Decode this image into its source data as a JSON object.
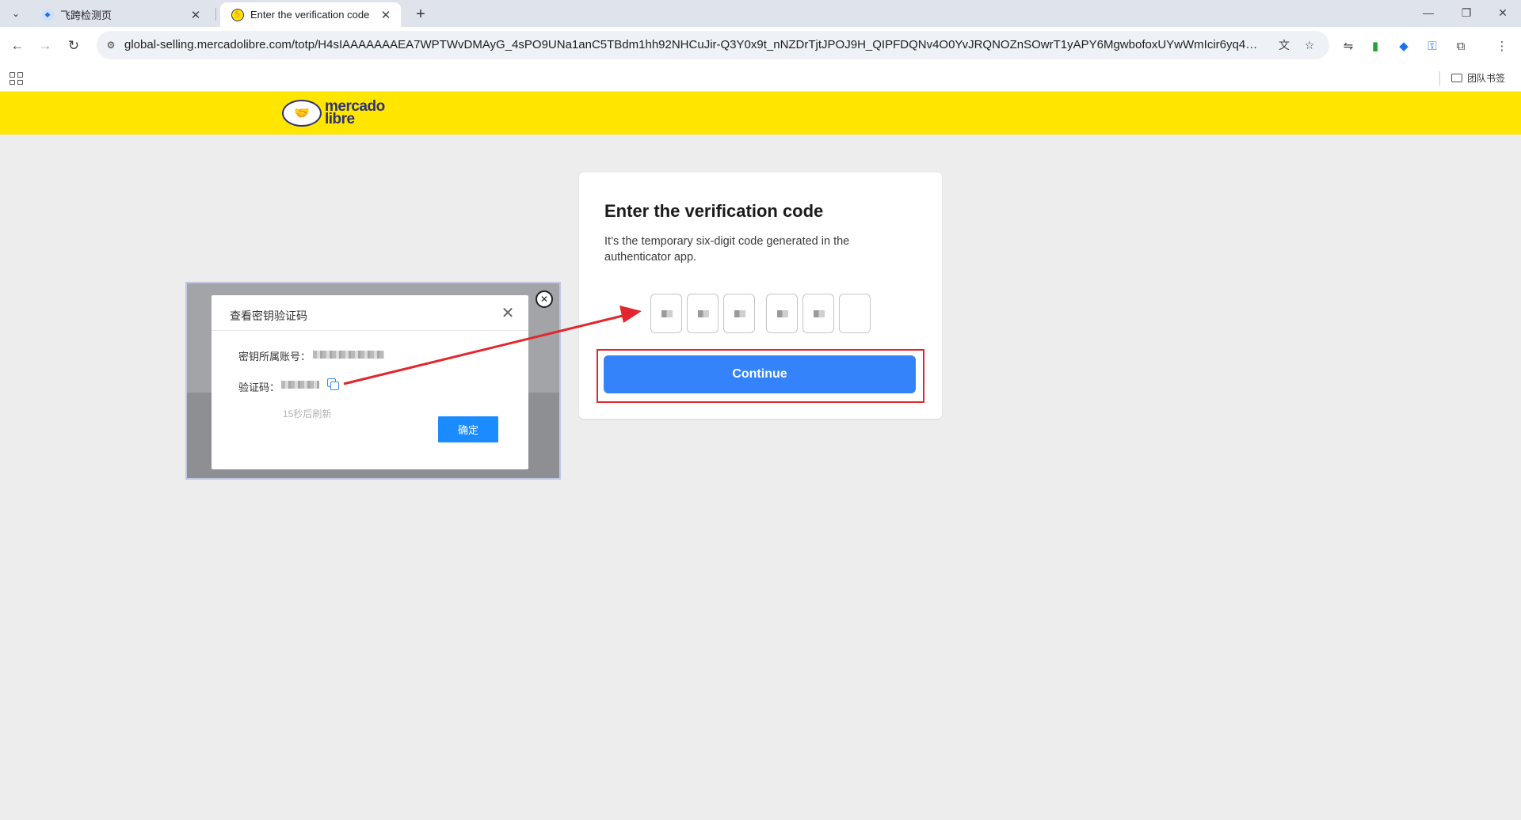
{
  "browser": {
    "tabs": [
      {
        "title": "飞跨检测页",
        "icon": "shield-icon",
        "active": false
      },
      {
        "title": "Enter the verification code",
        "icon": "mercadolibre-favicon",
        "active": true
      }
    ],
    "address": {
      "url": "global-selling.mercadolibre.com/totp/H4sIAAAAAAAEA7WPTWvDMAyG_4sPO9UNa1anC5TBdm1hh92NHCuJir-Q3Y0x9t_nNZDrTjtJPOJ9H_QIPFDQNv4O0YvJRQNOZnSOwrT1yAPY6MgwbofoxUYwWmIcir6yq4G5IJT7..."
    },
    "bookmarks": {
      "folder_label": "团队书签"
    },
    "accent_color": "#1a73e8"
  },
  "page": {
    "brand": {
      "line1": "mercado",
      "line2": "libre",
      "color": "#2d3277",
      "header_color": "#ffe600"
    },
    "card": {
      "title": "Enter the verification code",
      "description": "It’s the temporary six-digit code generated in the authenticator app.",
      "code_boxes": 6,
      "code_boxes_filled": 5,
      "continue_label": "Continue",
      "button_color": "#3483fa",
      "highlight_color": "#e3262d"
    }
  },
  "popup": {
    "title": "查看密钥验证码",
    "account_label": "密钥所属账号：",
    "code_label": "验证码：",
    "refresh_text": "15秒后刷新",
    "confirm_label": "确定",
    "confirm_color": "#1a8cff"
  },
  "annotation": {
    "arrow_color": "#e3262d"
  }
}
